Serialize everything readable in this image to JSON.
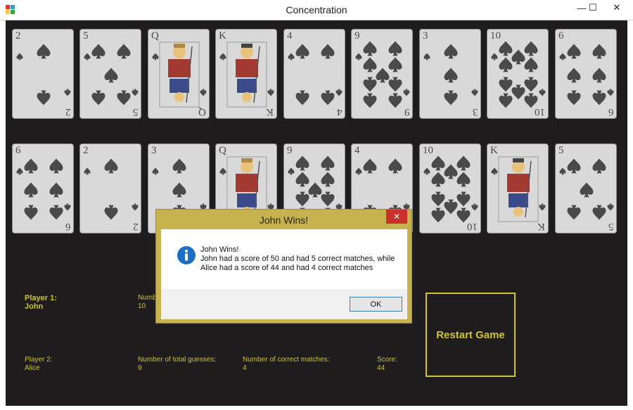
{
  "window": {
    "title": "Concentration",
    "minimize_symbol": "—",
    "maximize_symbol": "☐",
    "close_symbol": "✕"
  },
  "cards": {
    "row1": [
      {
        "rank": "2",
        "kind": "pip",
        "pips": 2
      },
      {
        "rank": "5",
        "kind": "pip",
        "pips": 5
      },
      {
        "rank": "Q",
        "kind": "face"
      },
      {
        "rank": "K",
        "kind": "face"
      },
      {
        "rank": "4",
        "kind": "pip",
        "pips": 4
      },
      {
        "rank": "9",
        "kind": "pip",
        "pips": 9
      },
      {
        "rank": "3",
        "kind": "pip",
        "pips": 3
      },
      {
        "rank": "10",
        "kind": "pip",
        "pips": 10
      },
      {
        "rank": "6",
        "kind": "pip",
        "pips": 6
      }
    ],
    "row2": [
      {
        "rank": "6",
        "kind": "pip",
        "pips": 6
      },
      {
        "rank": "2",
        "kind": "pip",
        "pips": 2
      },
      {
        "rank": "3",
        "kind": "pip",
        "pips": 3
      },
      {
        "rank": "Q",
        "kind": "face"
      },
      {
        "rank": "9",
        "kind": "pip",
        "pips": 9
      },
      {
        "rank": "4",
        "kind": "pip",
        "pips": 4
      },
      {
        "rank": "10",
        "kind": "pip",
        "pips": 10
      },
      {
        "rank": "K",
        "kind": "face"
      },
      {
        "rank": "5",
        "kind": "pip",
        "pips": 5
      }
    ],
    "suit_symbol": "♠"
  },
  "player1": {
    "label": "Player 1:",
    "name": "John",
    "guesses_label": "Number of total guesses:",
    "guesses": "10"
  },
  "player2": {
    "label": "Player 2:",
    "name": "Alice",
    "guesses_label": "Number of total guesses:",
    "guesses": "9",
    "matches_label": "Number of correct matches:",
    "matches": "4",
    "score_label": "Score:",
    "score": "44"
  },
  "restart_label": "Restart Game",
  "dialog": {
    "title": "John Wins!",
    "line1": "John Wins!",
    "line2": "John had a score of 50 and had 5 correct matches, while",
    "line3": "Alice had a score of 44 and had 4 correct matches",
    "ok_label": "OK",
    "close_symbol": "✕"
  },
  "colors": {
    "board": "#1e1c1d",
    "card": "#d9d9d9",
    "accent": "#cfc430",
    "dialog_frame": "#c7b34d",
    "close_red": "#c9312a"
  }
}
